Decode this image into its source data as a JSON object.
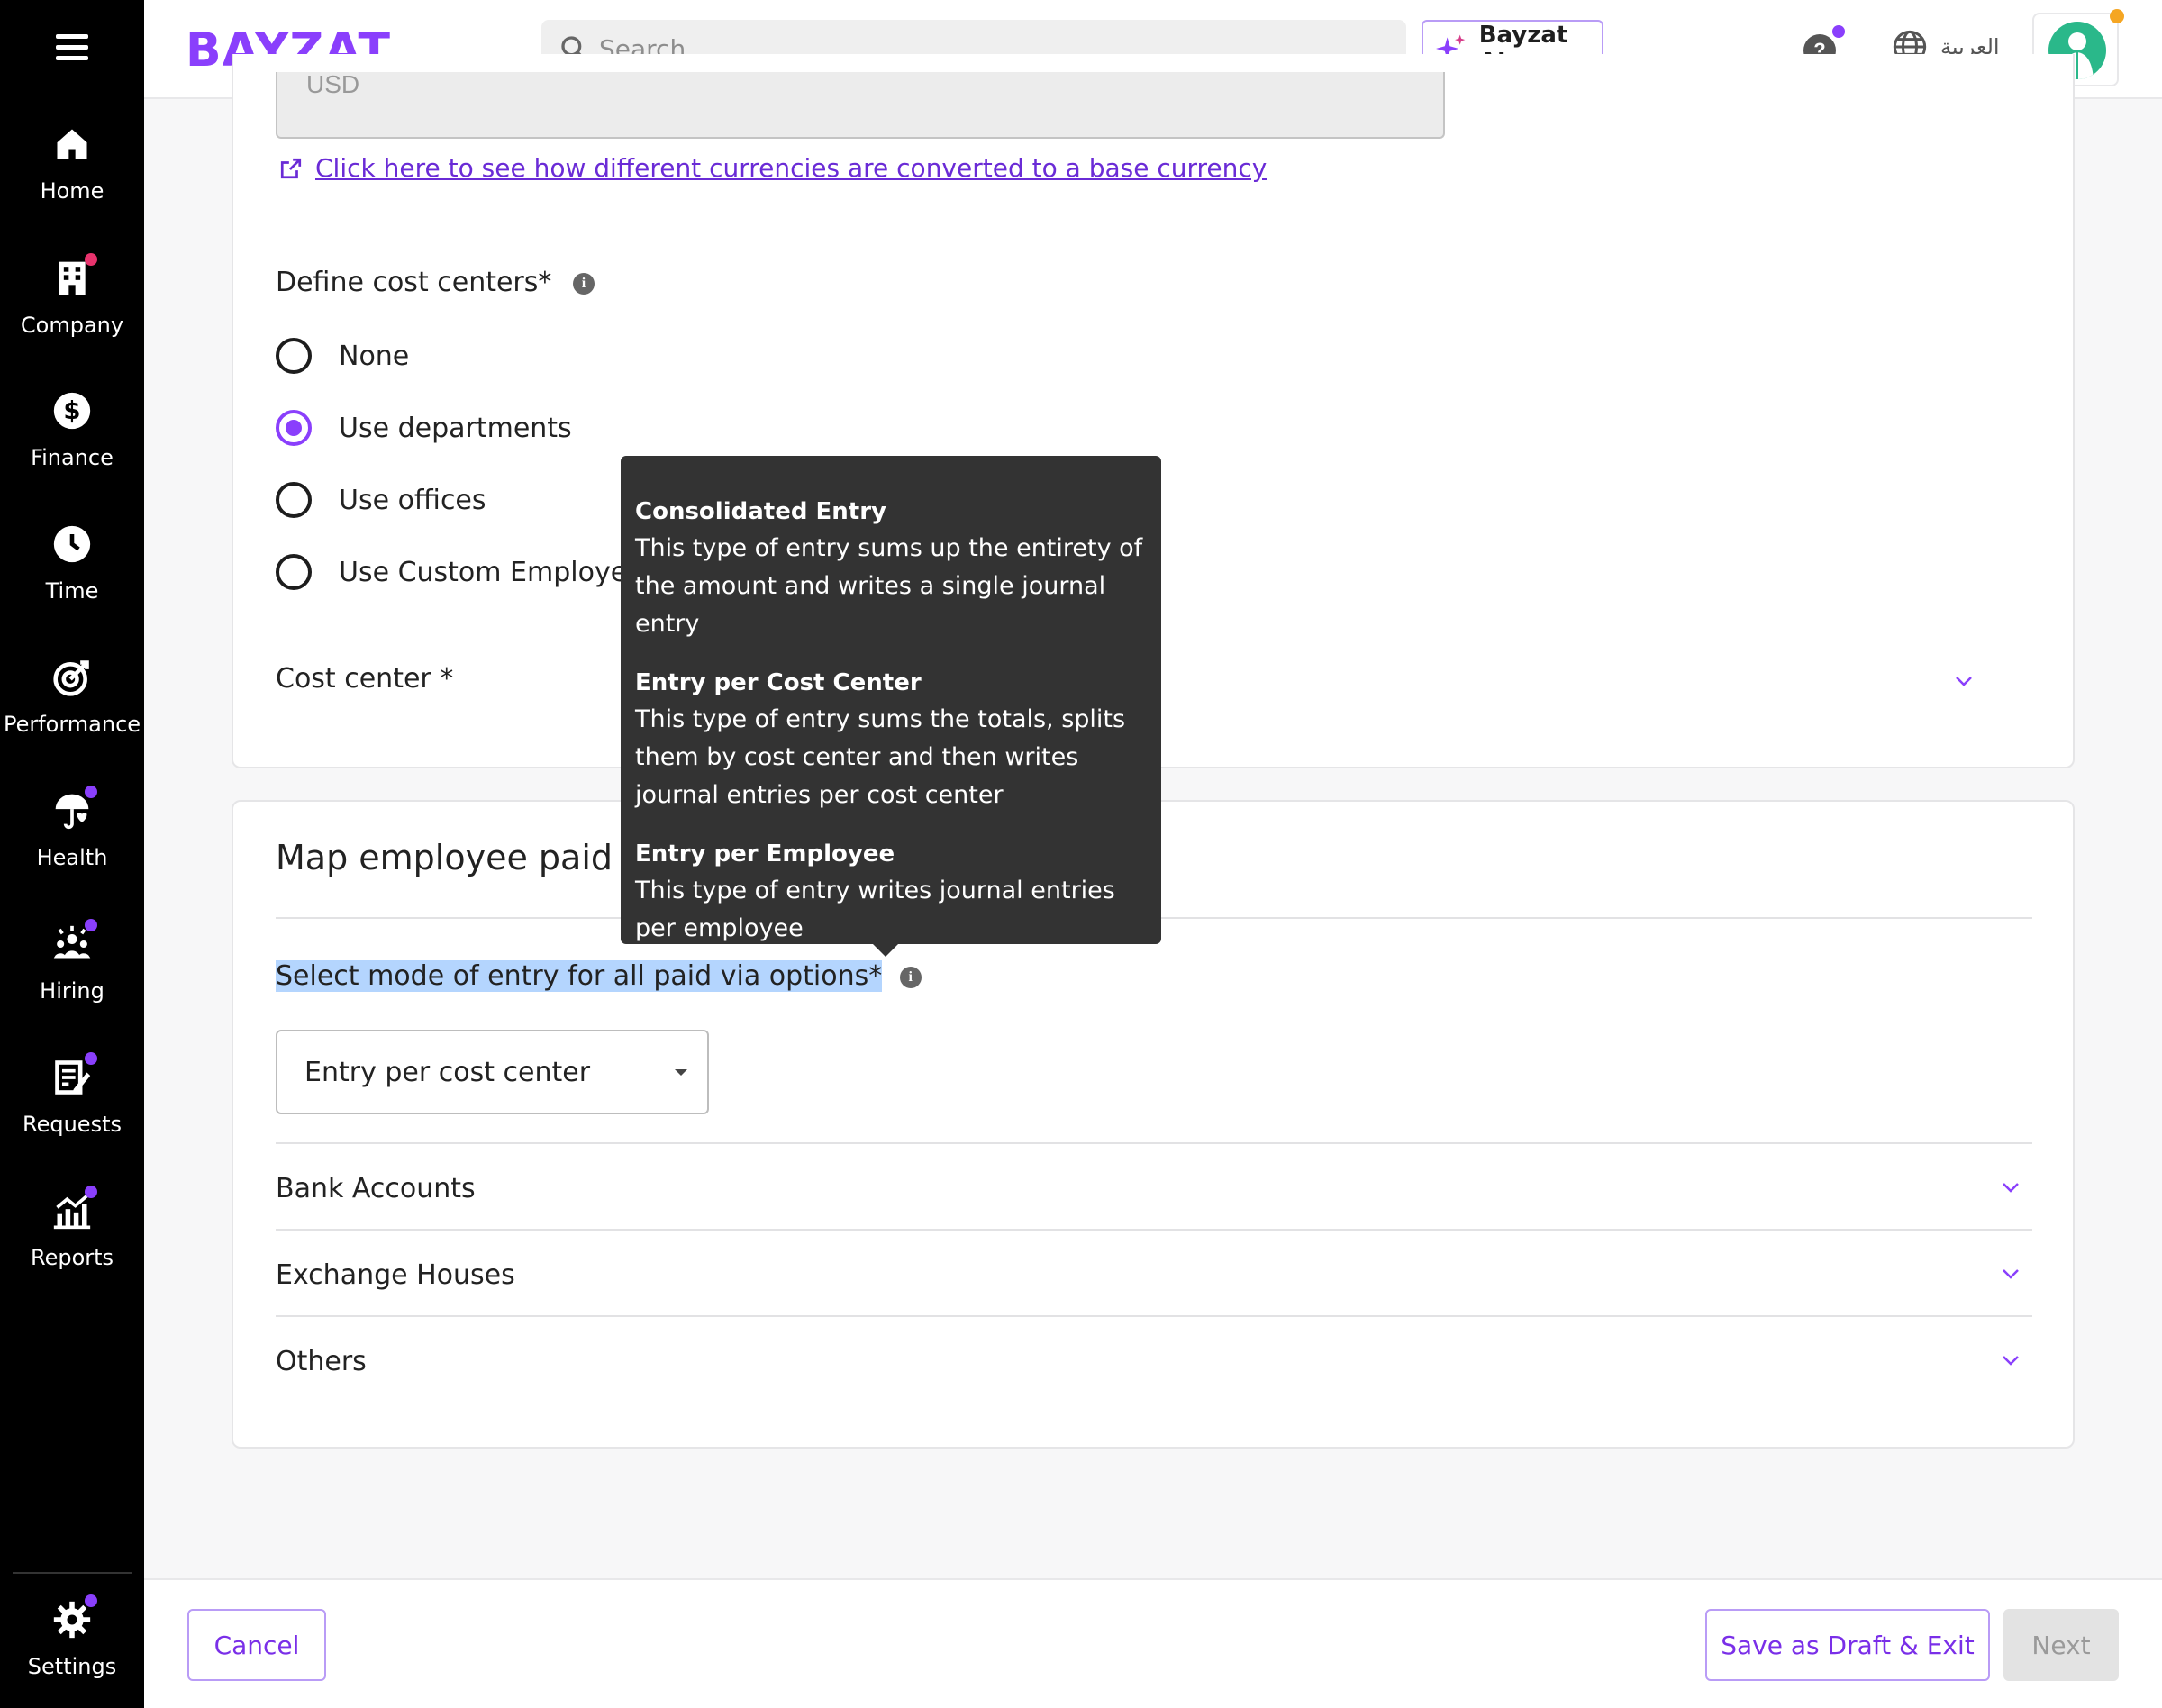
{
  "sidebar": {
    "items": [
      {
        "label": "Home",
        "icon": "home-icon",
        "badge": null
      },
      {
        "label": "Company",
        "icon": "building-icon",
        "badge": "red"
      },
      {
        "label": "Finance",
        "icon": "dollar-icon",
        "badge": null
      },
      {
        "label": "Time",
        "icon": "clock-icon",
        "badge": null
      },
      {
        "label": "Performance",
        "icon": "target-icon",
        "badge": null
      },
      {
        "label": "Health",
        "icon": "umbrella-heart-icon",
        "badge": "purple"
      },
      {
        "label": "Hiring",
        "icon": "people-icon",
        "badge": "purple"
      },
      {
        "label": "Requests",
        "icon": "clipboard-icon",
        "badge": "purple"
      },
      {
        "label": "Reports",
        "icon": "chart-icon",
        "badge": "purple"
      }
    ],
    "settings_label": "Settings"
  },
  "header": {
    "logo": "BAYZAT",
    "search_placeholder": "Search",
    "ai_label": "Bayzat AI",
    "help": "?",
    "language": "العربية"
  },
  "colors": {
    "accent": "#8a3ffc",
    "link": "#6a2bd6",
    "tooltip_bg": "#333333",
    "highlight": "#b4d5fe"
  },
  "form": {
    "currency_value": "USD",
    "conversion_link": "Click here to see how different currencies are converted to a base currency",
    "cost_centers_label": "Define cost centers*",
    "cost_center_options": [
      "None",
      "Use departments",
      "Use offices",
      "Use Custom Employee Data"
    ],
    "cost_center_selected": "Use departments",
    "cost_center_field_label": "Cost center *"
  },
  "map_section": {
    "title": "Map employee paid via",
    "mode_label": "Select mode of entry for all paid via options*",
    "mode_value": "Entry per cost center",
    "accordions": [
      "Bank Accounts",
      "Exchange Houses",
      "Others"
    ]
  },
  "tooltip": {
    "entries": [
      {
        "title": "Consolidated Entry",
        "body": "This type of entry sums up the entirety of the amount and writes a single journal entry"
      },
      {
        "title": "Entry per Cost Center",
        "body": "This type of entry sums the totals, splits them by cost center and then writes journal entries per cost center"
      },
      {
        "title": "Entry per Employee",
        "body": "This type of entry writes journal entries per employee"
      }
    ]
  },
  "footer": {
    "cancel": "Cancel",
    "save_draft": "Save as Draft & Exit",
    "next": "Next"
  }
}
